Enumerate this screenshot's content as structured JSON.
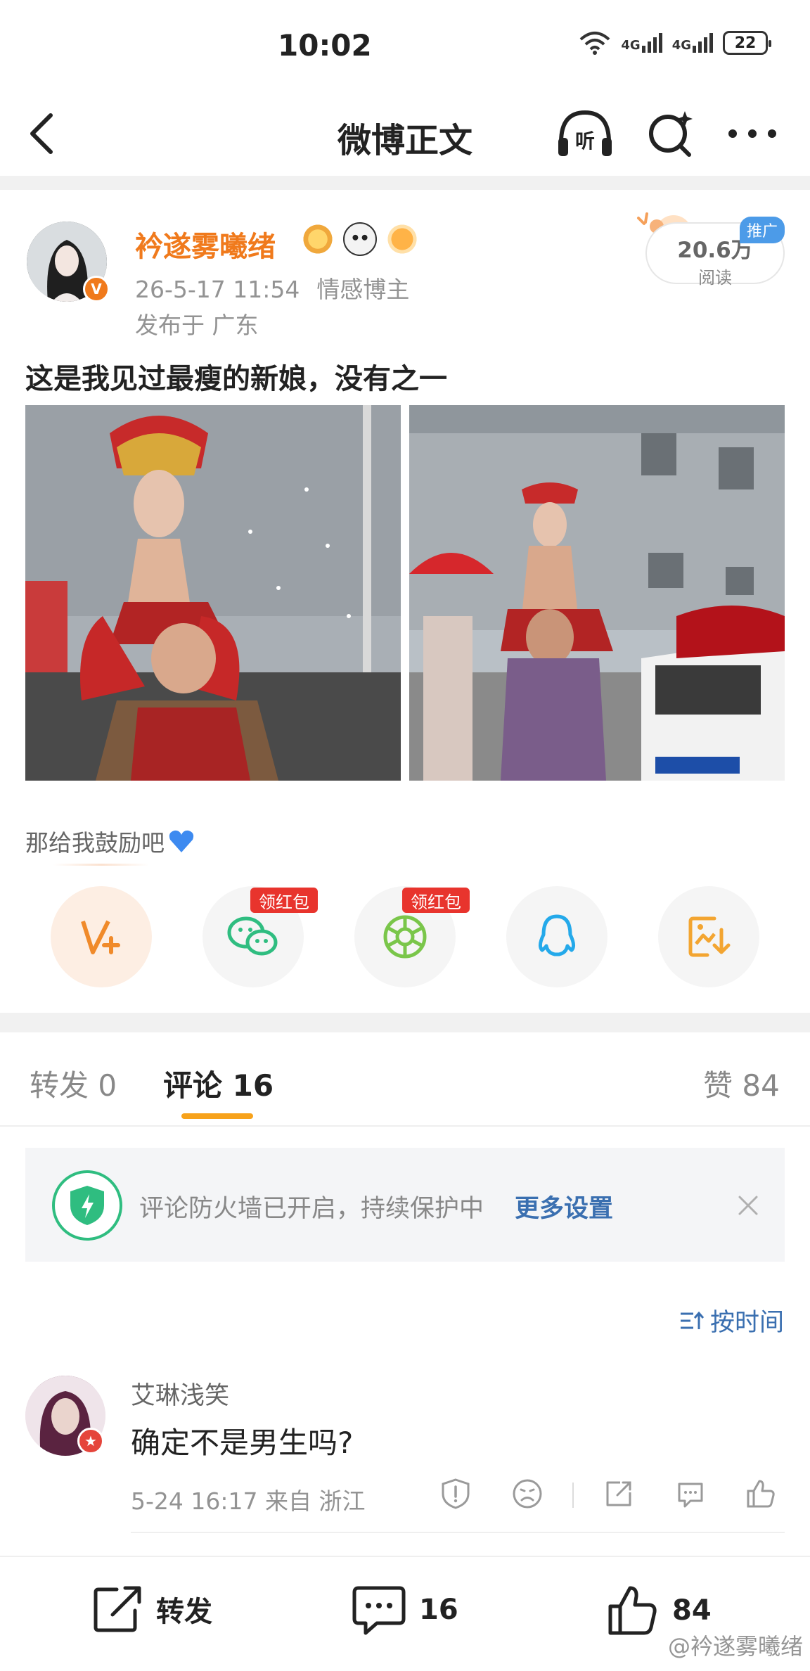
{
  "status_bar": {
    "time": "10:02",
    "network_1": "4G",
    "network_2": "4G",
    "battery": "22"
  },
  "nav": {
    "title": "微博正文",
    "listen_icon_text": "听"
  },
  "post": {
    "author": "衿遂雾曦绪",
    "date": "26-5-17 11:54",
    "tag": "情感博主",
    "location": "发布于 广东",
    "reads": "20.6万",
    "reads_label": "阅读",
    "promo": "推广",
    "text": "这是我见过最瘦的新娘，没有之一",
    "verified_badge": "V"
  },
  "encourage_text": "那给我鼓励吧",
  "share": {
    "redpack_label": "领红包"
  },
  "tabs": {
    "repost": "转发 0",
    "comment": "评论 16",
    "like": "赞 84"
  },
  "firewall": {
    "text": "评论防火墙已开启，持续保护中",
    "link": "更多设置"
  },
  "sort_label": "按时间",
  "comment": {
    "user": "艾琳浅笑",
    "text": "确定不是男生吗?",
    "meta": "5-24 16:17  来自 浙江"
  },
  "bottom_bar": {
    "repost": "转发",
    "comments": "16",
    "likes": "84"
  },
  "watermark": "@衿遂雾曦绪",
  "colors": {
    "accent_orange": "#f07a1c",
    "link_blue": "#3a6fb0",
    "redpack": "#e8342d",
    "tab_underline": "#f7a21b"
  }
}
